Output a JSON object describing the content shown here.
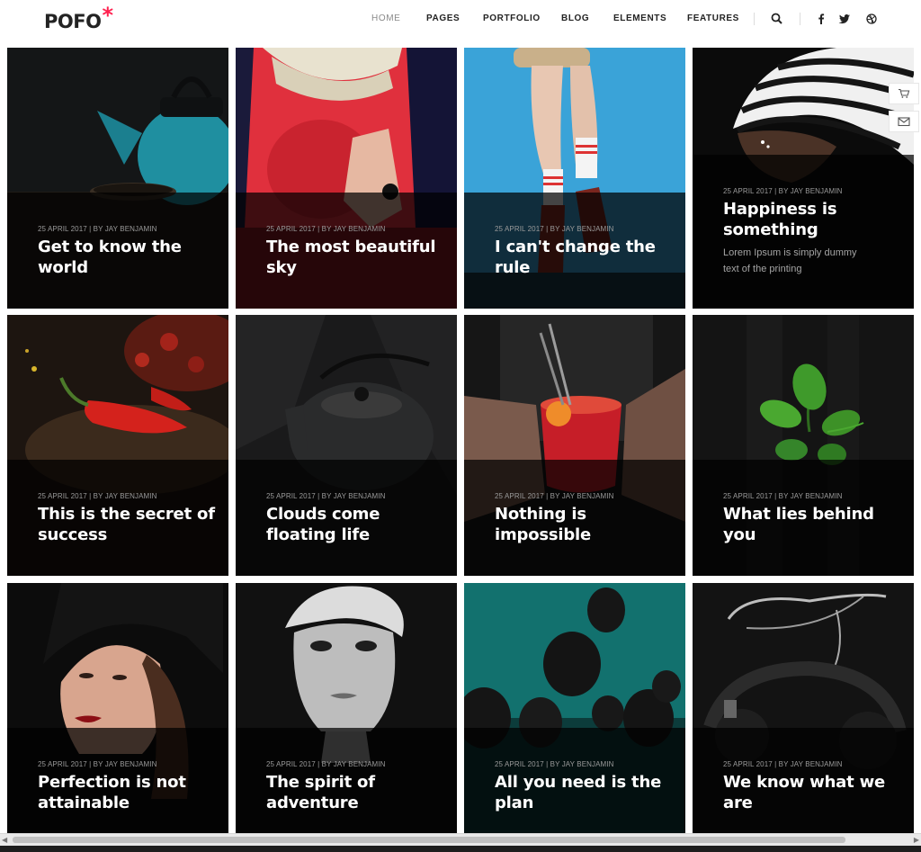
{
  "header": {
    "logo": "POFO",
    "logo_mark": "*",
    "nav": [
      "HOME",
      "PAGES",
      "PORTFOLIO",
      "BLOG",
      "ELEMENTS",
      "FEATURES"
    ],
    "active_nav": "HOME",
    "icons": [
      "search-icon",
      "facebook-icon",
      "twitter-icon",
      "dribbble-icon"
    ]
  },
  "side_buttons": [
    "cart-icon",
    "mail-icon"
  ],
  "posts": [
    {
      "meta": "25 APRIL 2017 | BY JAY BENJAMIN",
      "title": "Get to know the world",
      "scene": "teapot-teal"
    },
    {
      "meta": "25 APRIL 2017 | BY JAY BENJAMIN",
      "title": "The most beautiful sky",
      "scene": "red-portrait"
    },
    {
      "meta": "25 APRIL 2017 | BY JAY BENJAMIN",
      "title": "I can't change the rule",
      "scene": "legs-blue"
    },
    {
      "meta": "25 APRIL 2017 | BY JAY BENJAMIN",
      "title": "Happiness is something",
      "excerpt": "Lorem Ipsum is simply dummy text of the printing",
      "scene": "striped-hat"
    },
    {
      "meta": "25 APRIL 2017 | BY JAY BENJAMIN",
      "title": "This is the secret of success",
      "scene": "chili"
    },
    {
      "meta": "25 APRIL 2017 | BY JAY BENJAMIN",
      "title": "Clouds come floating life",
      "scene": "cast-iron-teapot"
    },
    {
      "meta": "25 APRIL 2017 | BY JAY BENJAMIN",
      "title": "Nothing is impossible",
      "scene": "cocktail"
    },
    {
      "meta": "25 APRIL 2017 | BY JAY BENJAMIN",
      "title": "What lies behind you",
      "scene": "basil"
    },
    {
      "meta": "25 APRIL 2017 | BY JAY BENJAMIN",
      "title": "Perfection is not attainable",
      "scene": "woman-hat"
    },
    {
      "meta": "25 APRIL 2017 | BY JAY BENJAMIN",
      "title": "The spirit of adventure",
      "scene": "bw-portrait"
    },
    {
      "meta": "25 APRIL 2017 | BY JAY BENJAMIN",
      "title": "All you need is the plan",
      "scene": "balloons"
    },
    {
      "meta": "25 APRIL 2017 | BY JAY BENJAMIN",
      "title": "We know what we are",
      "scene": "headphones"
    }
  ],
  "colors": {
    "accent": "#ff214f",
    "overlay": "#000000",
    "page": "#ffffff"
  }
}
